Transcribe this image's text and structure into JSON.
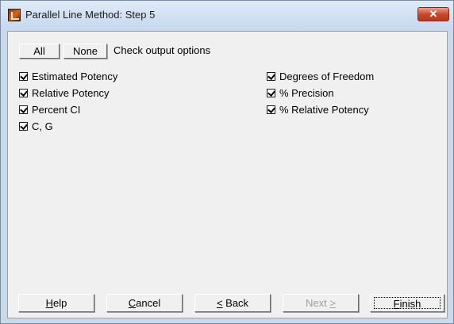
{
  "window": {
    "title": "Parallel Line Method: Step 5",
    "close_glyph": "✕"
  },
  "toolbar": {
    "all_label": "All",
    "none_label": "None",
    "caption": "Check output options"
  },
  "options": {
    "left": [
      {
        "label": "Estimated Potency",
        "checked": true
      },
      {
        "label": "Relative Potency",
        "checked": true
      },
      {
        "label": "Percent CI",
        "checked": true
      },
      {
        "label": "C, G",
        "checked": true
      }
    ],
    "right": [
      {
        "label": "Degrees of Freedom",
        "checked": true
      },
      {
        "label": "% Precision",
        "checked": true
      },
      {
        "label": "% Relative Potency",
        "checked": true
      }
    ]
  },
  "buttons": {
    "help": {
      "mnemonic": "H",
      "rest": "elp"
    },
    "cancel": {
      "mnemonic": "C",
      "rest": "ancel"
    },
    "back": {
      "mnemonic": "<",
      "rest": " Back"
    },
    "next": {
      "prefix": "Next ",
      "mnemonic": ">"
    },
    "finish": {
      "mnemonic": "F",
      "rest": "inish"
    }
  }
}
